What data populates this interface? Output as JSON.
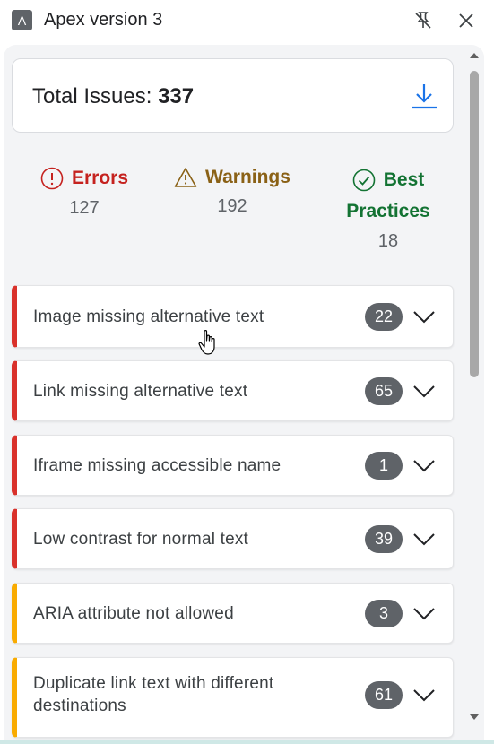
{
  "window": {
    "app_icon_letter": "A",
    "title": "Apex version 3"
  },
  "summary": {
    "total_label": "Total Issues:",
    "total_count": "337"
  },
  "stats": {
    "errors": {
      "label": "Errors",
      "value": "127",
      "color": "#c5221f"
    },
    "warnings": {
      "label": "Warnings",
      "value": "192",
      "color": "#8a6116"
    },
    "best_practices": {
      "label_line1": "Best",
      "label_line2": "Practices",
      "value": "18",
      "color": "#137333"
    }
  },
  "issues": [
    {
      "label_line1": "Image missing alternative text",
      "count": "22",
      "severity": "error"
    },
    {
      "label_line1": "Link missing alternative text",
      "count": "65",
      "severity": "error"
    },
    {
      "label_line1": "Iframe missing accessible name",
      "count": "1",
      "severity": "error"
    },
    {
      "label_line1": "Low contrast for normal text",
      "count": "39",
      "severity": "error"
    },
    {
      "label_line1": "ARIA attribute not allowed",
      "count": "3",
      "severity": "warning"
    },
    {
      "label_line1": "Duplicate link text with different",
      "label_line2": "destinations",
      "count": "61",
      "severity": "warning"
    }
  ],
  "icons": {
    "pin": "unpin-icon",
    "close": "close-icon",
    "download": "download-icon",
    "error": "error-circle-icon",
    "warning": "warning-triangle-icon",
    "best": "check-circle-icon",
    "expand": "chevron-down-icon"
  },
  "colors": {
    "error_bar": "#d9312b",
    "warning_bar": "#f9ab00",
    "badge": "#5f6368",
    "accent": "#1a73e8"
  }
}
